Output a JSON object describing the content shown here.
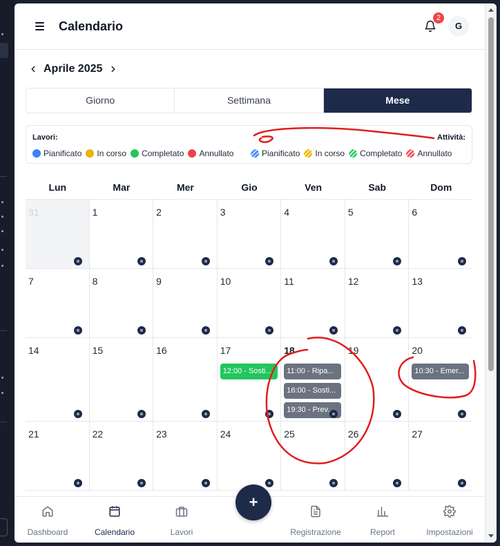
{
  "header": {
    "title": "Calendario",
    "notifications_count": "2",
    "avatar_initial": "G"
  },
  "month_nav": {
    "label": "Aprile 2025"
  },
  "view_tabs": [
    {
      "label": "Giorno",
      "active": false
    },
    {
      "label": "Settimana",
      "active": false
    },
    {
      "label": "Mese",
      "active": true
    }
  ],
  "legend": {
    "lavori_title": "Lavori:",
    "attivita_title": "Attività:",
    "lavori": [
      {
        "label": "Pianificato",
        "color": "#3b82f6"
      },
      {
        "label": "In corso",
        "color": "#eab308"
      },
      {
        "label": "Completato",
        "color": "#22c55e"
      },
      {
        "label": "Annullato",
        "color": "#ef4444"
      }
    ],
    "attivita": [
      {
        "label": "Pianificato",
        "color": "#3b82f6"
      },
      {
        "label": "In corso",
        "color": "#eab308"
      },
      {
        "label": "Completato",
        "color": "#22c55e"
      },
      {
        "label": "Annullato",
        "color": "#ef4444"
      }
    ]
  },
  "weekdays": [
    "Lun",
    "Mar",
    "Mer",
    "Gio",
    "Ven",
    "Sab",
    "Dom"
  ],
  "weeks": [
    [
      "31",
      "1",
      "2",
      "3",
      "4",
      "5",
      "6"
    ],
    [
      "7",
      "8",
      "9",
      "10",
      "11",
      "12",
      "13"
    ],
    [
      "14",
      "15",
      "16",
      "17",
      "18",
      "19",
      "20"
    ],
    [
      "21",
      "22",
      "23",
      "24",
      "25",
      "26",
      "27"
    ]
  ],
  "events": {
    "d17": [
      {
        "label": "12:00 - Sosti...",
        "color": "#22c55e"
      }
    ],
    "d18": [
      {
        "label": "11:00 - Ripa...",
        "color": "#6b7280"
      },
      {
        "label": "16:00 - Sosti...",
        "color": "#6b7280"
      },
      {
        "label": "19:30 - Prev...",
        "color": "#6b7280"
      }
    ],
    "d20": [
      {
        "label": "10:30 - Emer...",
        "color": "#6b7280"
      }
    ]
  },
  "fab_label": "+",
  "bottom_nav": [
    {
      "label": "Dashboard",
      "icon": "home-icon"
    },
    {
      "label": "Calendario",
      "icon": "calendar-icon"
    },
    {
      "label": "Lavori",
      "icon": "briefcase-icon"
    },
    {
      "label": "Registrazione",
      "icon": "document-icon"
    },
    {
      "label": "Report",
      "icon": "bar-chart-icon"
    },
    {
      "label": "Impostazioni",
      "icon": "settings-icon"
    }
  ],
  "colors": {
    "primary": "#1e2a4a",
    "annotation": "#e11d1d"
  }
}
